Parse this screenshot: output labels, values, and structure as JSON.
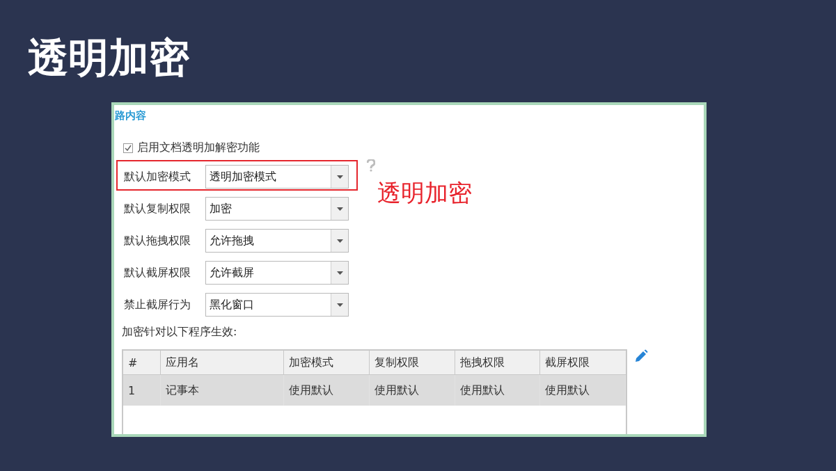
{
  "slide_title": "透明加密",
  "panel": {
    "section_heading": "路内容",
    "enable_option": {
      "label": "启用文档透明加解密功能",
      "checked": true
    },
    "settings": [
      {
        "label": "默认加密模式",
        "value": "透明加密模式",
        "highlighted": true
      },
      {
        "label": "默认复制权限",
        "value": "加密",
        "highlighted": false
      },
      {
        "label": "默认拖拽权限",
        "value": "允许拖拽",
        "highlighted": false
      },
      {
        "label": "默认截屏权限",
        "value": "允许截屏",
        "highlighted": false
      },
      {
        "label": "禁止截屏行为",
        "value": "黑化窗口",
        "highlighted": false
      }
    ],
    "annotation": "透明加密",
    "table_caption": "加密针对以下程序生效:",
    "table": {
      "columns": [
        "#",
        "应用名",
        "加密模式",
        "复制权限",
        "拖拽权限",
        "截屏权限"
      ],
      "rows": [
        {
          "cells": [
            "1",
            "记事本",
            "使用默认",
            "使用默认",
            "使用默认",
            "使用默认"
          ],
          "selected": true
        }
      ]
    }
  }
}
